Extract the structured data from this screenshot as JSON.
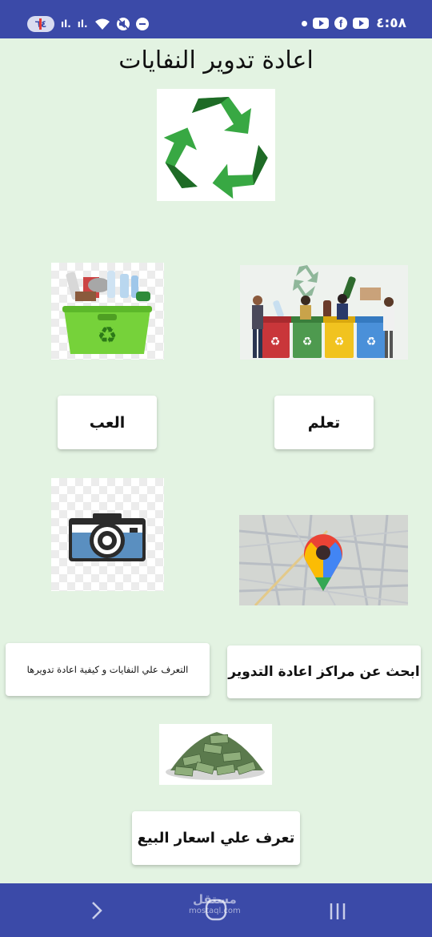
{
  "status_bar": {
    "battery": "٦٤",
    "signal_1": "ıl.",
    "signal_2": "ıl.",
    "time": "٤:٥٨",
    "icons": [
      "signal-icon",
      "wifi-icon",
      "mute-icon",
      "dnd-icon",
      "notification-dot-icon",
      "youtube-icon",
      "facebook-icon"
    ]
  },
  "page": {
    "title": "اعادة تدوير النفايات"
  },
  "buttons": {
    "learn": "تعلم",
    "play": "العب",
    "centers": "ابحث عن مراكز اعادة التدوير",
    "identify": "التعرف علي النفايات و كيفية اعادة تدويرها",
    "prices": "تعرف علي اسعار البيع"
  },
  "images": {
    "logo": "recycle-logo",
    "bins": "recycling-bins-people",
    "basket": "recycle-basket",
    "map": "map-location",
    "camera": "camera",
    "money": "money-pile"
  },
  "nav": {
    "watermark_main": "مستقل",
    "watermark_sub": "mostaql.com"
  },
  "colors": {
    "bar": "#3b4aa8",
    "background": "#e3f3e2",
    "recycle_green": "#2e8b3a"
  }
}
